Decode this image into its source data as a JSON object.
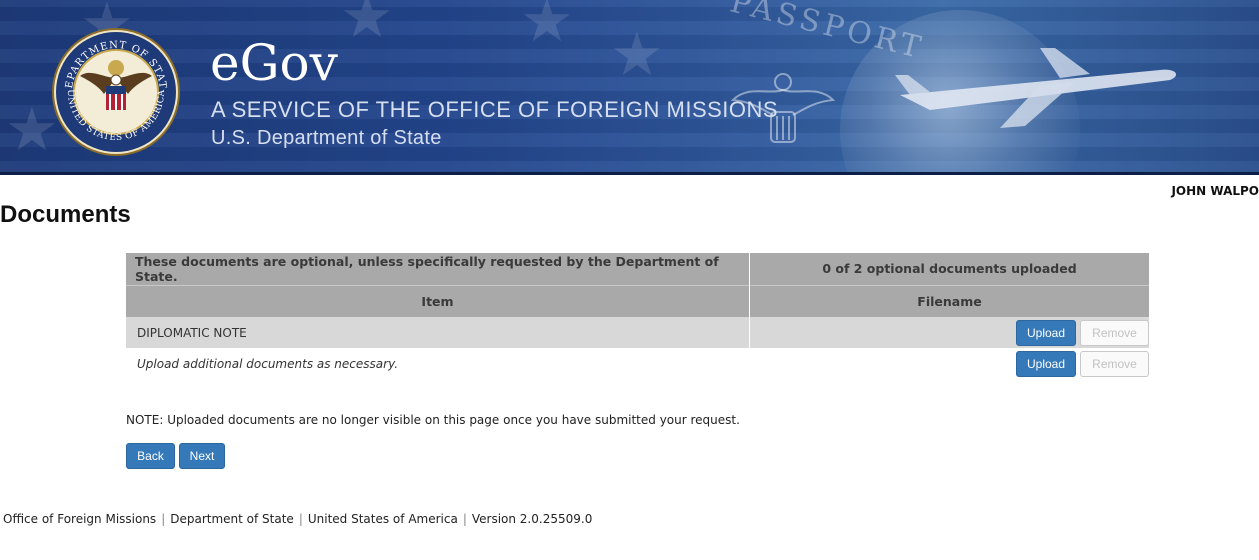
{
  "header": {
    "title": "eGov",
    "subtitle": "A SERVICE OF THE OFFICE OF FOREIGN MISSIONS",
    "department": "U.S. Department of State",
    "background_word": "PASSPORT",
    "seal_top_text": "DEPARTMENT OF STATE",
    "seal_bottom_text": "UNITED STATES OF AMERICA",
    "seal_icon": "department-of-state-seal-icon",
    "brand_color": "#22458c"
  },
  "user": {
    "name": "JOHN WALPO"
  },
  "page": {
    "title": "Documents"
  },
  "documents": {
    "info_text": "These documents are optional, unless specifically requested by the Department of State.",
    "count_text": "0 of 2 optional documents uploaded",
    "columns": [
      "Item",
      "Filename"
    ],
    "rows": [
      {
        "item": "DIPLOMATIC NOTE",
        "filename": "",
        "upload_label": "Upload",
        "remove_label": "Remove"
      }
    ],
    "additional": {
      "text": "Upload additional documents as necessary.",
      "upload_label": "Upload",
      "remove_label": "Remove"
    }
  },
  "note": "NOTE: Uploaded documents are no longer visible on this page once you have submitted your request.",
  "nav": {
    "back_label": "Back",
    "next_label": "Next"
  },
  "footer": {
    "items": [
      "Office of Foreign Missions",
      "Department of State",
      "United States of America",
      "Version 2.0.25509.0"
    ]
  },
  "colors": {
    "primary_button": "#3579b8",
    "table_header": "#a9a9a9",
    "row_bg": "#d8d8d8"
  }
}
